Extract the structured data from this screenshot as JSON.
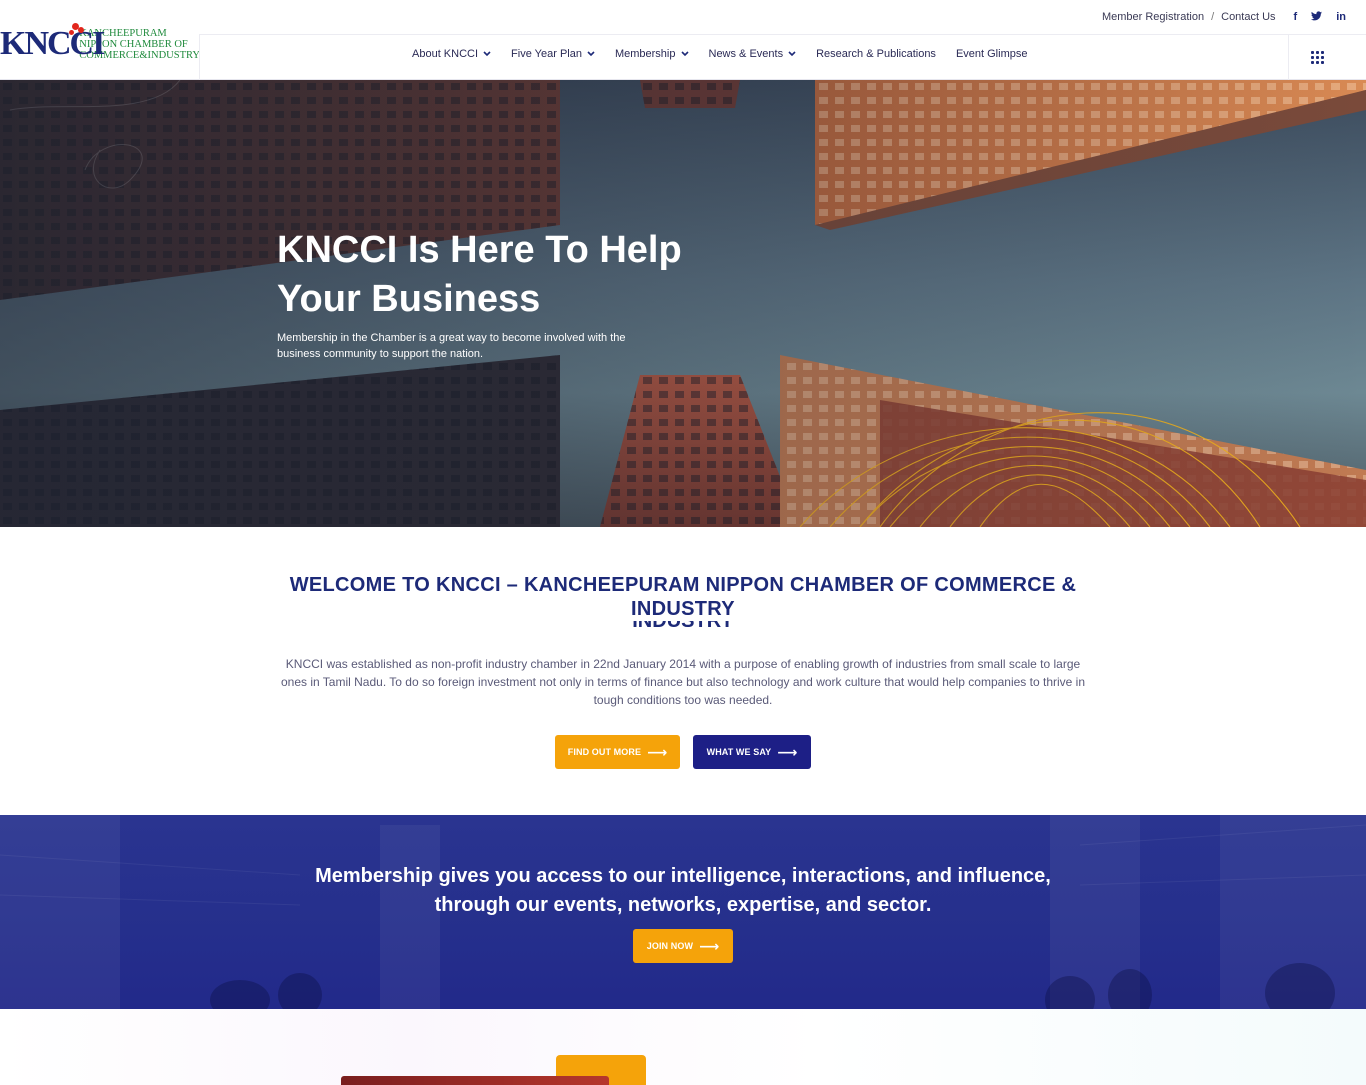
{
  "brand": {
    "logo_letters": "KNCCI",
    "logo_lines": [
      "KANCHEEPURAM",
      "NIPPON CHAMBER OF",
      "COMMERCE&INDUSTRY"
    ]
  },
  "topbar": {
    "member_registration": "Member Registration",
    "separator": "/",
    "contact_us": "Contact Us",
    "social": [
      "f",
      "t",
      "in"
    ]
  },
  "nav": {
    "items": [
      {
        "label": "About KNCCI",
        "has_dropdown": true
      },
      {
        "label": "Five Year Plan",
        "has_dropdown": true
      },
      {
        "label": "Membership",
        "has_dropdown": true
      },
      {
        "label": "News & Events",
        "has_dropdown": true
      },
      {
        "label": "Research & Publications",
        "has_dropdown": false
      },
      {
        "label": "Event Glimpse",
        "has_dropdown": false
      }
    ],
    "chevron": "❯"
  },
  "hero": {
    "title": "KNCCI Is Here To Help Your Business",
    "subtitle": "Membership in the Chamber is a great way to become involved with the business community to support the nation."
  },
  "welcome": {
    "title": "WELCOME TO KNCCI – KANCHEEPURAM NIPPON CHAMBER OF COMMERCE & INDUSTRY",
    "ghost": "INDUSTRY",
    "text": "KNCCI was established as non-profit industry chamber in 22nd January 2014 with a purpose of enabling growth of industries from small scale to large ones in Tamil Nadu. To do so foreign investment not only in terms of finance but also technology and work culture that would help companies to thrive in tough conditions too was needed.",
    "find_out_more": "FIND OUT MORE",
    "what_we_say": "WHAT WE SAY"
  },
  "band": {
    "text": "Membership gives you access to our intelligence, interactions, and influence, through our events, networks, expertise, and sector.",
    "join_now": "JOIN NOW"
  },
  "icons": {
    "arrow": "⟶"
  },
  "colors": {
    "navy": "#1d2a78",
    "orange": "#f5a30a",
    "band": "#252f8c",
    "logo_green": "#1f8a3c",
    "logo_red": "#e2261c"
  }
}
